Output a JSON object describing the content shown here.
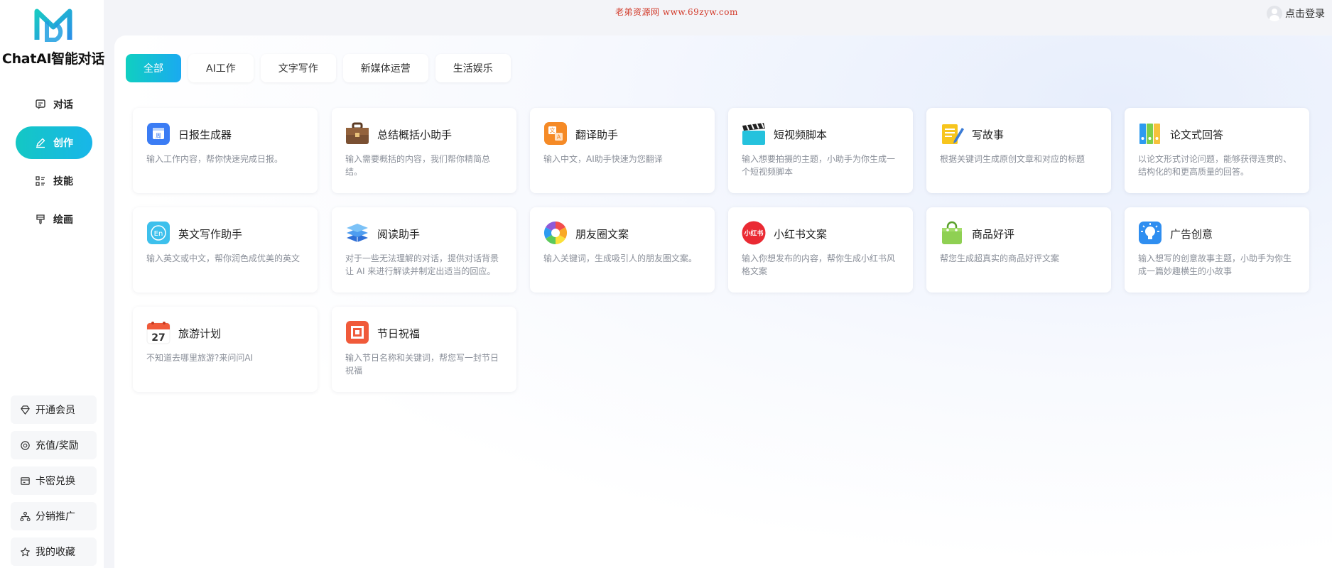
{
  "app": {
    "title": "ChatAI智能对话"
  },
  "topbar": {
    "watermark": "老弟资源网 www.69zyw.com",
    "login_label": "点击登录"
  },
  "nav": [
    {
      "label": "对话",
      "icon": "chat-icon"
    },
    {
      "label": "创作",
      "icon": "edit-icon",
      "active": true
    },
    {
      "label": "技能",
      "icon": "skills-icon"
    },
    {
      "label": "绘画",
      "icon": "paint-brush-icon"
    }
  ],
  "bottom_nav": [
    {
      "label": "开通会员",
      "icon": "diamond-icon"
    },
    {
      "label": "充值/奖励",
      "icon": "coin-icon"
    },
    {
      "label": "卡密兑换",
      "icon": "card-icon"
    },
    {
      "label": "分销推广",
      "icon": "network-icon"
    },
    {
      "label": "我的收藏",
      "icon": "star-icon"
    }
  ],
  "tabs": [
    {
      "label": "全部",
      "active": true
    },
    {
      "label": "AI工作"
    },
    {
      "label": "文字写作"
    },
    {
      "label": "新媒体运营"
    },
    {
      "label": "生活娱乐"
    }
  ],
  "cards": [
    {
      "title": "日报生成器",
      "desc": "输入工作内容，帮你快速完成日报。",
      "icon": "daily-report-icon"
    },
    {
      "title": "总结概括小助手",
      "desc": "输入需要概括的内容，我们帮你精简总结。",
      "icon": "briefcase-icon"
    },
    {
      "title": "翻译助手",
      "desc": "输入中文，AI助手快速为您翻译",
      "icon": "translate-icon"
    },
    {
      "title": "短视频脚本",
      "desc": "输入想要拍摄的主题，小助手为你生成一个短视频脚本",
      "icon": "clapperboard-icon"
    },
    {
      "title": "写故事",
      "desc": "根据关键词生成原创文章和对应的标题",
      "icon": "notepad-pen-icon"
    },
    {
      "title": "论文式回答",
      "desc": "以论文形式讨论问题，能够获得连贯的、结构化的和更高质量的回答。",
      "icon": "binders-icon"
    },
    {
      "title": "英文写作助手",
      "desc": "输入英文或中文，帮你润色成优美的英文",
      "icon": "english-icon"
    },
    {
      "title": "阅读助手",
      "desc": "对于一些无法理解的对话，提供对话背景让 AI 来进行解读并制定出适当的回应。",
      "icon": "books-icon"
    },
    {
      "title": "朋友圈文案",
      "desc": "输入关键词，生成吸引人的朋友圈文案。",
      "icon": "aperture-icon"
    },
    {
      "title": "小红书文案",
      "desc": "输入你想发布的内容，帮你生成小红书风格文案",
      "icon": "xiaohongshu-icon",
      "icon_text": "小红书"
    },
    {
      "title": "商品好评",
      "desc": "帮您生成超真实的商品好评文案",
      "icon": "shopping-bag-icon"
    },
    {
      "title": "广告创意",
      "desc": "输入想写的创意故事主题，小助手为你生成一篇妙趣横生的小故事",
      "icon": "lightbulb-icon"
    },
    {
      "title": "旅游计划",
      "desc": "不知道去哪里旅游?来问问AI",
      "icon": "calendar-icon",
      "icon_text": "27"
    },
    {
      "title": "节日祝福",
      "desc": "输入节日名称和关键词，帮您写一封节日祝福",
      "icon": "greeting-card-icon"
    }
  ]
}
